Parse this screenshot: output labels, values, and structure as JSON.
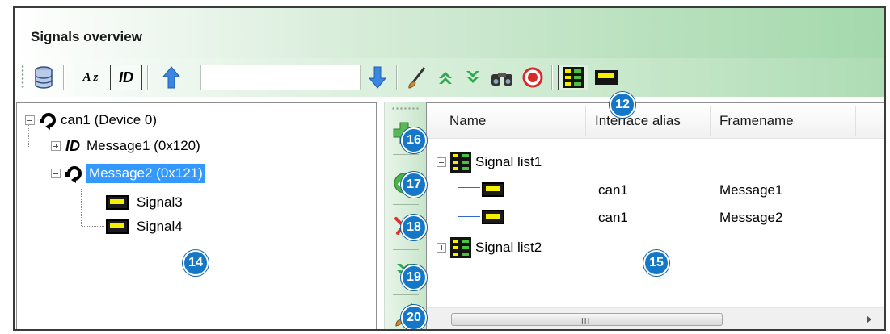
{
  "panel": {
    "title": "Signals overview"
  },
  "toolbar": {
    "sort_az_label": "A z",
    "id_label": "ID",
    "search_value": ""
  },
  "tree": {
    "root": {
      "label": "can1 (Device 0)"
    },
    "message1": {
      "prefix": "ID",
      "label": "Message1 (0x120)"
    },
    "message2": {
      "label": "Message2 (0x121)"
    },
    "signal3": {
      "label": "Signal3"
    },
    "signal4": {
      "label": "Signal4"
    }
  },
  "grid": {
    "columns": [
      "Name",
      "Interface alias",
      "Framename"
    ],
    "group1": {
      "label": "Signal list1"
    },
    "rows": [
      {
        "interface_alias": "can1",
        "framename": "Message1"
      },
      {
        "interface_alias": "can1",
        "framename": "Message2"
      }
    ],
    "group2": {
      "label": "Signal list2"
    },
    "scroll_grip": "III"
  },
  "callouts": {
    "c12": "12",
    "c14": "14",
    "c15": "15",
    "c16": "16",
    "c17": "17",
    "c18": "18",
    "c19": "19",
    "c20": "20"
  },
  "colors": {
    "header_green": "#a4d9ac",
    "selection_blue": "#3399ff",
    "callout_blue": "#1577c8",
    "signal_yellow": "#f4f000"
  }
}
